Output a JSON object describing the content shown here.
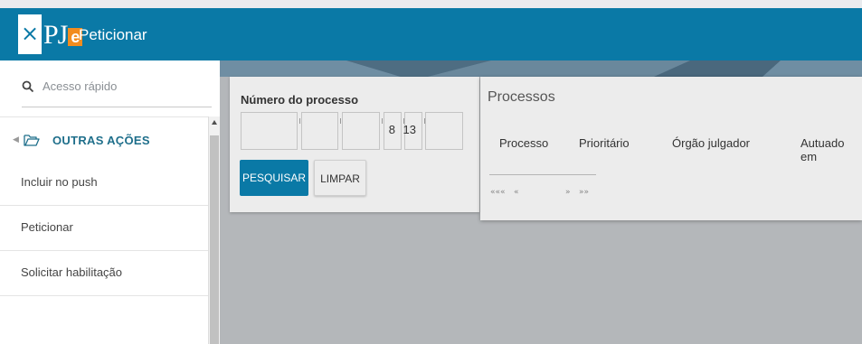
{
  "header": {
    "close_symbol": "×",
    "logo_prefix": "PJ",
    "logo_suffix": "e",
    "title": "Peticionar"
  },
  "sidebar": {
    "search_placeholder": "Acesso rápido",
    "group": {
      "label": "OUTRAS AÇÕES"
    },
    "items": [
      {
        "label": "Incluir no push"
      },
      {
        "label": "Peticionar"
      },
      {
        "label": "Solicitar habilitação"
      }
    ]
  },
  "form": {
    "label": "Número do processo",
    "fields": [
      {
        "value": ""
      },
      {
        "value": ""
      },
      {
        "value": ""
      },
      {
        "value": "8"
      },
      {
        "value": "13"
      },
      {
        "value": ""
      }
    ],
    "search_button": "PESQUISAR",
    "clear_button": "LIMPAR"
  },
  "processos": {
    "title": "Processos",
    "columns": [
      "Processo",
      "Prioritário",
      "Órgão julgador",
      "Autuado em"
    ],
    "pager": {
      "first": "«««",
      "prev": "«",
      "next": "»",
      "last": "»»"
    }
  },
  "colors": {
    "header": "#0a79a6",
    "logo_accent": "#f28c1e",
    "primary_button": "#0a79a6",
    "background": "#b4b7ba"
  },
  "icons": [
    "close-icon",
    "search-icon",
    "folder-open-icon",
    "chevron-left-icon",
    "scroll-up-arrow-icon"
  ]
}
